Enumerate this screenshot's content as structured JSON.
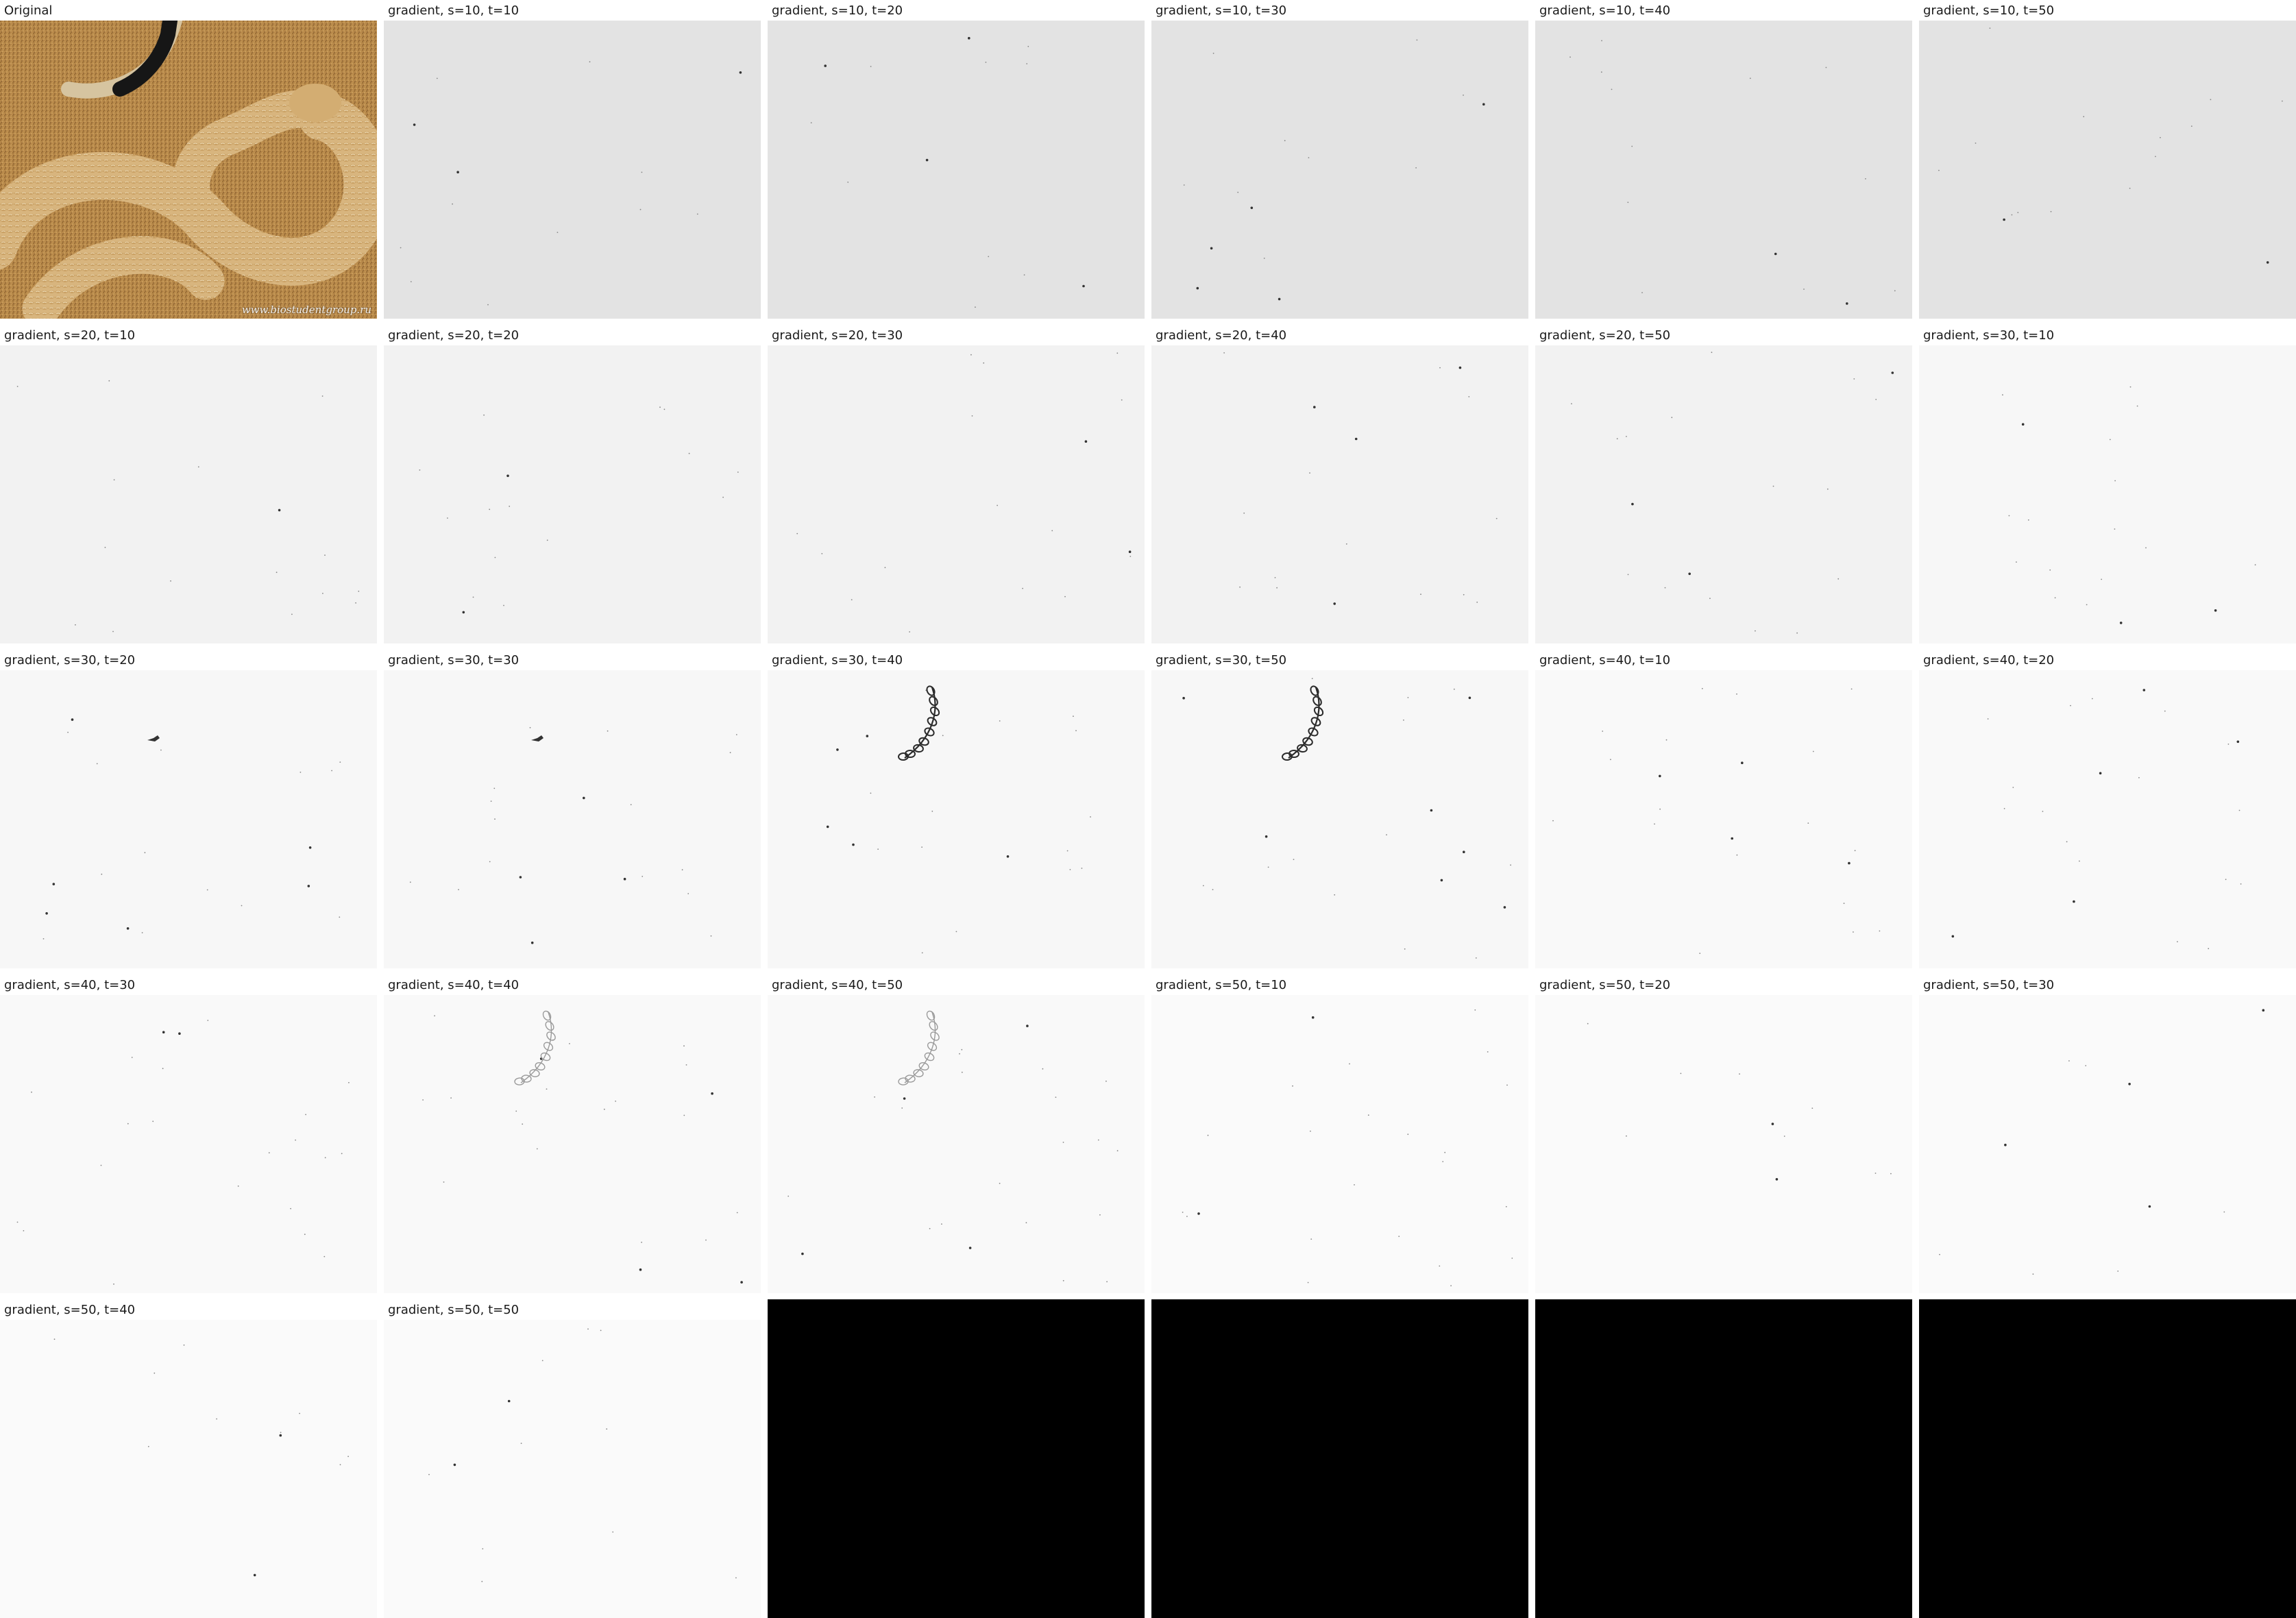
{
  "original": {
    "label": "Original",
    "watermark": "www.biostudentgroup.ru"
  },
  "panels": [
    {
      "label": "gradient, s=10, t=10",
      "shade": "#e3e3e3",
      "feature": "none"
    },
    {
      "label": "gradient, s=10, t=20",
      "shade": "#e3e3e3",
      "feature": "none"
    },
    {
      "label": "gradient, s=10, t=30",
      "shade": "#e3e3e3",
      "feature": "none"
    },
    {
      "label": "gradient, s=10, t=40",
      "shade": "#e3e3e3",
      "feature": "none"
    },
    {
      "label": "gradient, s=10, t=50",
      "shade": "#e3e3e3",
      "feature": "none"
    },
    {
      "label": "gradient, s=20, t=10",
      "shade": "#f2f2f2",
      "feature": "none"
    },
    {
      "label": "gradient, s=20, t=20",
      "shade": "#f2f2f2",
      "feature": "none"
    },
    {
      "label": "gradient, s=20, t=30",
      "shade": "#f2f2f2",
      "feature": "none"
    },
    {
      "label": "gradient, s=20, t=40",
      "shade": "#f2f2f2",
      "feature": "none"
    },
    {
      "label": "gradient, s=20, t=50",
      "shade": "#f2f2f2",
      "feature": "none"
    },
    {
      "label": "gradient, s=30, t=10",
      "shade": "#f7f7f7",
      "feature": "none"
    },
    {
      "label": "gradient, s=30, t=20",
      "shade": "#f7f7f7",
      "feature": "small-mark"
    },
    {
      "label": "gradient, s=30, t=30",
      "shade": "#f7f7f7",
      "feature": "small-mark"
    },
    {
      "label": "gradient, s=30, t=40",
      "shade": "#f7f7f7",
      "feature": "tail-dark"
    },
    {
      "label": "gradient, s=30, t=50",
      "shade": "#f7f7f7",
      "feature": "tail-dark"
    },
    {
      "label": "gradient, s=40, t=10",
      "shade": "#f9f9f9",
      "feature": "none"
    },
    {
      "label": "gradient, s=40, t=20",
      "shade": "#f9f9f9",
      "feature": "none"
    },
    {
      "label": "gradient, s=40, t=30",
      "shade": "#f9f9f9",
      "feature": "none"
    },
    {
      "label": "gradient, s=40, t=40",
      "shade": "#f9f9f9",
      "feature": "tail-light"
    },
    {
      "label": "gradient, s=40, t=50",
      "shade": "#f9f9f9",
      "feature": "tail-light"
    },
    {
      "label": "gradient, s=50, t=10",
      "shade": "#fafafa",
      "feature": "none"
    },
    {
      "label": "gradient, s=50, t=20",
      "shade": "#fafafa",
      "feature": "none"
    },
    {
      "label": "gradient, s=50, t=30",
      "shade": "#fafafa",
      "feature": "none"
    },
    {
      "label": "gradient, s=50, t=40",
      "shade": "#fafafa",
      "feature": "none"
    },
    {
      "label": "gradient, s=50, t=50",
      "shade": "#fafafa",
      "feature": "none"
    }
  ],
  "empty_tiles": 4,
  "colors": {
    "sand": "#b88a45",
    "snake": "#d6b27a",
    "tail": "#1a1a1a",
    "empty": "#000000"
  }
}
